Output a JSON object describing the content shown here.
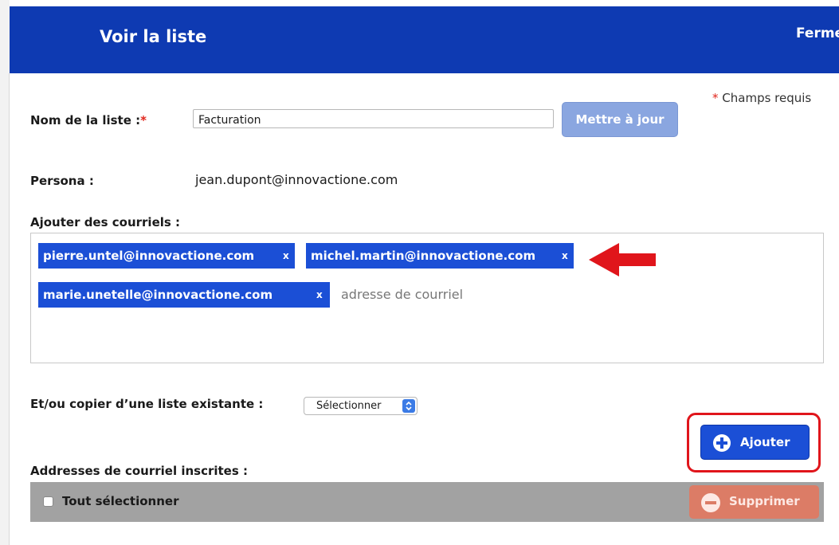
{
  "header": {
    "title": "Voir la liste",
    "close_label": "Fermer"
  },
  "form": {
    "required_note": "Champs requis",
    "list_name_label": "Nom de la liste :",
    "list_name_value": "Facturation",
    "update_button": "Mettre à jour",
    "persona_label": "Persona :",
    "persona_value": "jean.dupont@innovactione.com",
    "add_emails_label": "Ajouter des courriels :",
    "email_tags": [
      "pierre.untel@innovactione.com",
      "michel.martin@innovactione.com",
      "marie.unetelle@innovactione.com"
    ],
    "tag_remove_symbol": "x",
    "email_placeholder": "adresse de courriel",
    "copy_list_label": "Et/ou copier d’une liste existante :",
    "copy_list_select": "Sélectionner",
    "add_button": "Ajouter",
    "registered_label": "Addresses de courriel inscrites :",
    "select_all_label": "Tout sélectionner",
    "delete_button": "Supprimer"
  },
  "colors": {
    "header_bg": "#0e3ab2",
    "tag_bg": "#1b4fd6",
    "annotation_red": "#e0151b",
    "delete_bg": "#dc7c66"
  }
}
